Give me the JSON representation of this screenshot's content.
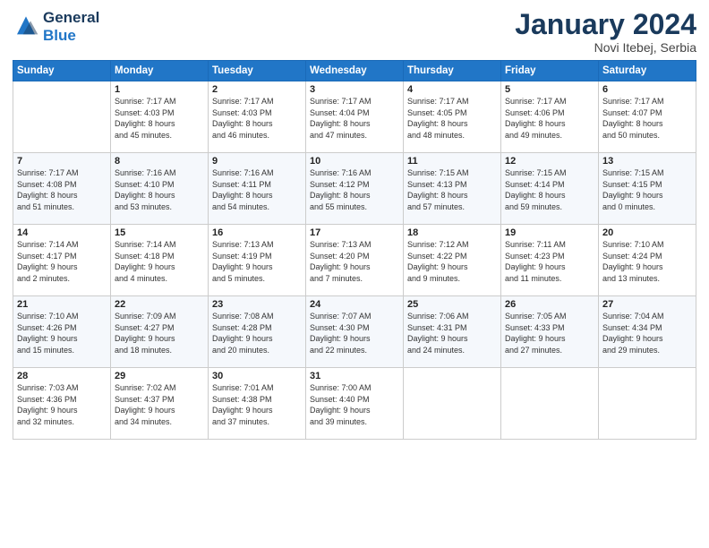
{
  "logo": {
    "line1": "General",
    "line2": "Blue"
  },
  "title": "January 2024",
  "location": "Novi Itebej, Serbia",
  "header_days": [
    "Sunday",
    "Monday",
    "Tuesday",
    "Wednesday",
    "Thursday",
    "Friday",
    "Saturday"
  ],
  "weeks": [
    [
      {
        "day": "",
        "info": ""
      },
      {
        "day": "1",
        "info": "Sunrise: 7:17 AM\nSunset: 4:03 PM\nDaylight: 8 hours\nand 45 minutes."
      },
      {
        "day": "2",
        "info": "Sunrise: 7:17 AM\nSunset: 4:03 PM\nDaylight: 8 hours\nand 46 minutes."
      },
      {
        "day": "3",
        "info": "Sunrise: 7:17 AM\nSunset: 4:04 PM\nDaylight: 8 hours\nand 47 minutes."
      },
      {
        "day": "4",
        "info": "Sunrise: 7:17 AM\nSunset: 4:05 PM\nDaylight: 8 hours\nand 48 minutes."
      },
      {
        "day": "5",
        "info": "Sunrise: 7:17 AM\nSunset: 4:06 PM\nDaylight: 8 hours\nand 49 minutes."
      },
      {
        "day": "6",
        "info": "Sunrise: 7:17 AM\nSunset: 4:07 PM\nDaylight: 8 hours\nand 50 minutes."
      }
    ],
    [
      {
        "day": "7",
        "info": "Sunrise: 7:17 AM\nSunset: 4:08 PM\nDaylight: 8 hours\nand 51 minutes."
      },
      {
        "day": "8",
        "info": "Sunrise: 7:16 AM\nSunset: 4:10 PM\nDaylight: 8 hours\nand 53 minutes."
      },
      {
        "day": "9",
        "info": "Sunrise: 7:16 AM\nSunset: 4:11 PM\nDaylight: 8 hours\nand 54 minutes."
      },
      {
        "day": "10",
        "info": "Sunrise: 7:16 AM\nSunset: 4:12 PM\nDaylight: 8 hours\nand 55 minutes."
      },
      {
        "day": "11",
        "info": "Sunrise: 7:15 AM\nSunset: 4:13 PM\nDaylight: 8 hours\nand 57 minutes."
      },
      {
        "day": "12",
        "info": "Sunrise: 7:15 AM\nSunset: 4:14 PM\nDaylight: 8 hours\nand 59 minutes."
      },
      {
        "day": "13",
        "info": "Sunrise: 7:15 AM\nSunset: 4:15 PM\nDaylight: 9 hours\nand 0 minutes."
      }
    ],
    [
      {
        "day": "14",
        "info": "Sunrise: 7:14 AM\nSunset: 4:17 PM\nDaylight: 9 hours\nand 2 minutes."
      },
      {
        "day": "15",
        "info": "Sunrise: 7:14 AM\nSunset: 4:18 PM\nDaylight: 9 hours\nand 4 minutes."
      },
      {
        "day": "16",
        "info": "Sunrise: 7:13 AM\nSunset: 4:19 PM\nDaylight: 9 hours\nand 5 minutes."
      },
      {
        "day": "17",
        "info": "Sunrise: 7:13 AM\nSunset: 4:20 PM\nDaylight: 9 hours\nand 7 minutes."
      },
      {
        "day": "18",
        "info": "Sunrise: 7:12 AM\nSunset: 4:22 PM\nDaylight: 9 hours\nand 9 minutes."
      },
      {
        "day": "19",
        "info": "Sunrise: 7:11 AM\nSunset: 4:23 PM\nDaylight: 9 hours\nand 11 minutes."
      },
      {
        "day": "20",
        "info": "Sunrise: 7:10 AM\nSunset: 4:24 PM\nDaylight: 9 hours\nand 13 minutes."
      }
    ],
    [
      {
        "day": "21",
        "info": "Sunrise: 7:10 AM\nSunset: 4:26 PM\nDaylight: 9 hours\nand 15 minutes."
      },
      {
        "day": "22",
        "info": "Sunrise: 7:09 AM\nSunset: 4:27 PM\nDaylight: 9 hours\nand 18 minutes."
      },
      {
        "day": "23",
        "info": "Sunrise: 7:08 AM\nSunset: 4:28 PM\nDaylight: 9 hours\nand 20 minutes."
      },
      {
        "day": "24",
        "info": "Sunrise: 7:07 AM\nSunset: 4:30 PM\nDaylight: 9 hours\nand 22 minutes."
      },
      {
        "day": "25",
        "info": "Sunrise: 7:06 AM\nSunset: 4:31 PM\nDaylight: 9 hours\nand 24 minutes."
      },
      {
        "day": "26",
        "info": "Sunrise: 7:05 AM\nSunset: 4:33 PM\nDaylight: 9 hours\nand 27 minutes."
      },
      {
        "day": "27",
        "info": "Sunrise: 7:04 AM\nSunset: 4:34 PM\nDaylight: 9 hours\nand 29 minutes."
      }
    ],
    [
      {
        "day": "28",
        "info": "Sunrise: 7:03 AM\nSunset: 4:36 PM\nDaylight: 9 hours\nand 32 minutes."
      },
      {
        "day": "29",
        "info": "Sunrise: 7:02 AM\nSunset: 4:37 PM\nDaylight: 9 hours\nand 34 minutes."
      },
      {
        "day": "30",
        "info": "Sunrise: 7:01 AM\nSunset: 4:38 PM\nDaylight: 9 hours\nand 37 minutes."
      },
      {
        "day": "31",
        "info": "Sunrise: 7:00 AM\nSunset: 4:40 PM\nDaylight: 9 hours\nand 39 minutes."
      },
      {
        "day": "",
        "info": ""
      },
      {
        "day": "",
        "info": ""
      },
      {
        "day": "",
        "info": ""
      }
    ]
  ]
}
